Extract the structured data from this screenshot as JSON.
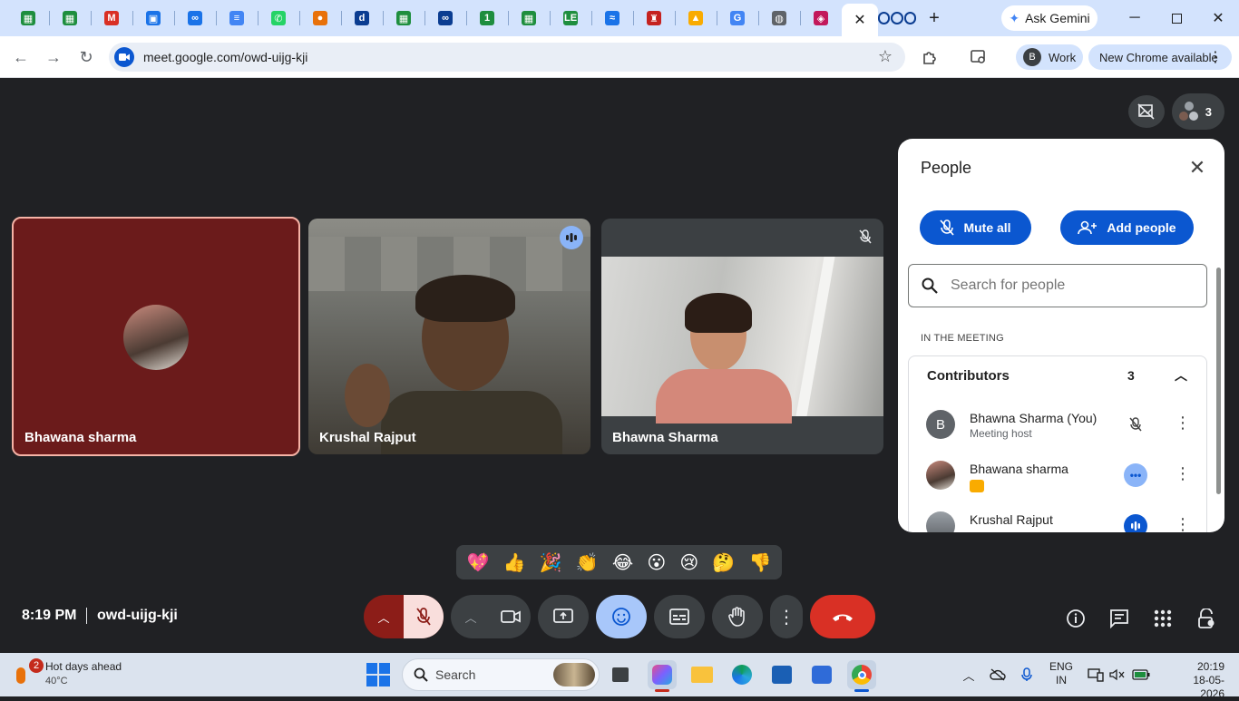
{
  "browser": {
    "tabs": [
      {
        "icon": "google-sheets-icon",
        "color": "#1e8e3e"
      },
      {
        "icon": "google-sheets-icon",
        "color": "#1e8e3e"
      },
      {
        "icon": "gmail-icon",
        "color": "#d93025"
      },
      {
        "icon": "calendar-icon",
        "color": "#1a73e8"
      },
      {
        "icon": "link-icon",
        "color": "#1a73e8"
      },
      {
        "icon": "google-docs-icon",
        "color": "#4285f4"
      },
      {
        "icon": "whatsapp-icon",
        "color": "#25d366"
      },
      {
        "icon": "bird-icon",
        "color": "#e8710a"
      },
      {
        "icon": "d-app-icon",
        "color": "#0b3d91"
      },
      {
        "icon": "google-sheets-icon",
        "color": "#1e8e3e"
      },
      {
        "icon": "infinity-icon",
        "color": "#0b3d91"
      },
      {
        "icon": "one-icon",
        "color": "#1e8e3e"
      },
      {
        "icon": "google-sheets-icon",
        "color": "#1e8e3e"
      },
      {
        "icon": "le-icon",
        "color": "#1e8e3e"
      },
      {
        "icon": "wave-icon",
        "color": "#1a73e8"
      },
      {
        "icon": "temple-icon",
        "color": "#c5221f"
      },
      {
        "icon": "shield-badge-icon",
        "color": "#f9ab00"
      },
      {
        "icon": "google-icon",
        "color": "#4285f4"
      },
      {
        "icon": "globe-icon",
        "color": "#5f6368"
      },
      {
        "icon": "crest-icon",
        "color": "#c2185b"
      }
    ],
    "active_tab_close": "✕",
    "extra_tab_icon": "chain-icon",
    "new_tab_label": "+",
    "gemini_label": "Ask Gemini",
    "url": "meet.google.com/owd-uijg-kji",
    "profile_initial": "B",
    "profile_label": "Work",
    "update_label": "New Chrome available"
  },
  "meet": {
    "participants_count": "3",
    "tiles": [
      {
        "name": "Bhawana sharma",
        "state": "camera-off"
      },
      {
        "name": "Krushal Rajput",
        "state": "speaking"
      },
      {
        "name": "Bhawna Sharma",
        "state": "muted"
      }
    ],
    "panel": {
      "title": "People",
      "mute_all": "Mute all",
      "add_people": "Add people",
      "search_placeholder": "Search for people",
      "section_label": "IN THE MEETING",
      "group_label": "Contributors",
      "group_count": "3",
      "people": [
        {
          "name": "Bhawna Sharma (You)",
          "sub": "Meeting host",
          "initial": "B",
          "state": "muted"
        },
        {
          "name": "Bhawana sharma",
          "sub": "",
          "initial": "",
          "state": "more-options"
        },
        {
          "name": "Krushal Rajput",
          "sub": "",
          "initial": "",
          "state": "speaking"
        }
      ]
    },
    "reactions": [
      "💖",
      "👍",
      "🎉",
      "👏",
      "😂",
      "😮",
      "😢",
      "🤔",
      "👎"
    ],
    "time": "8:19 PM",
    "meeting_code": "owd-uijg-kji"
  },
  "taskbar": {
    "weather_badge": "2",
    "weather_title": "Hot days ahead",
    "weather_temp": "40°C",
    "search_label": "Search",
    "lang_top": "ENG",
    "lang_bottom": "IN",
    "clock_time": "20:19",
    "clock_date": "18-05-2026"
  }
}
